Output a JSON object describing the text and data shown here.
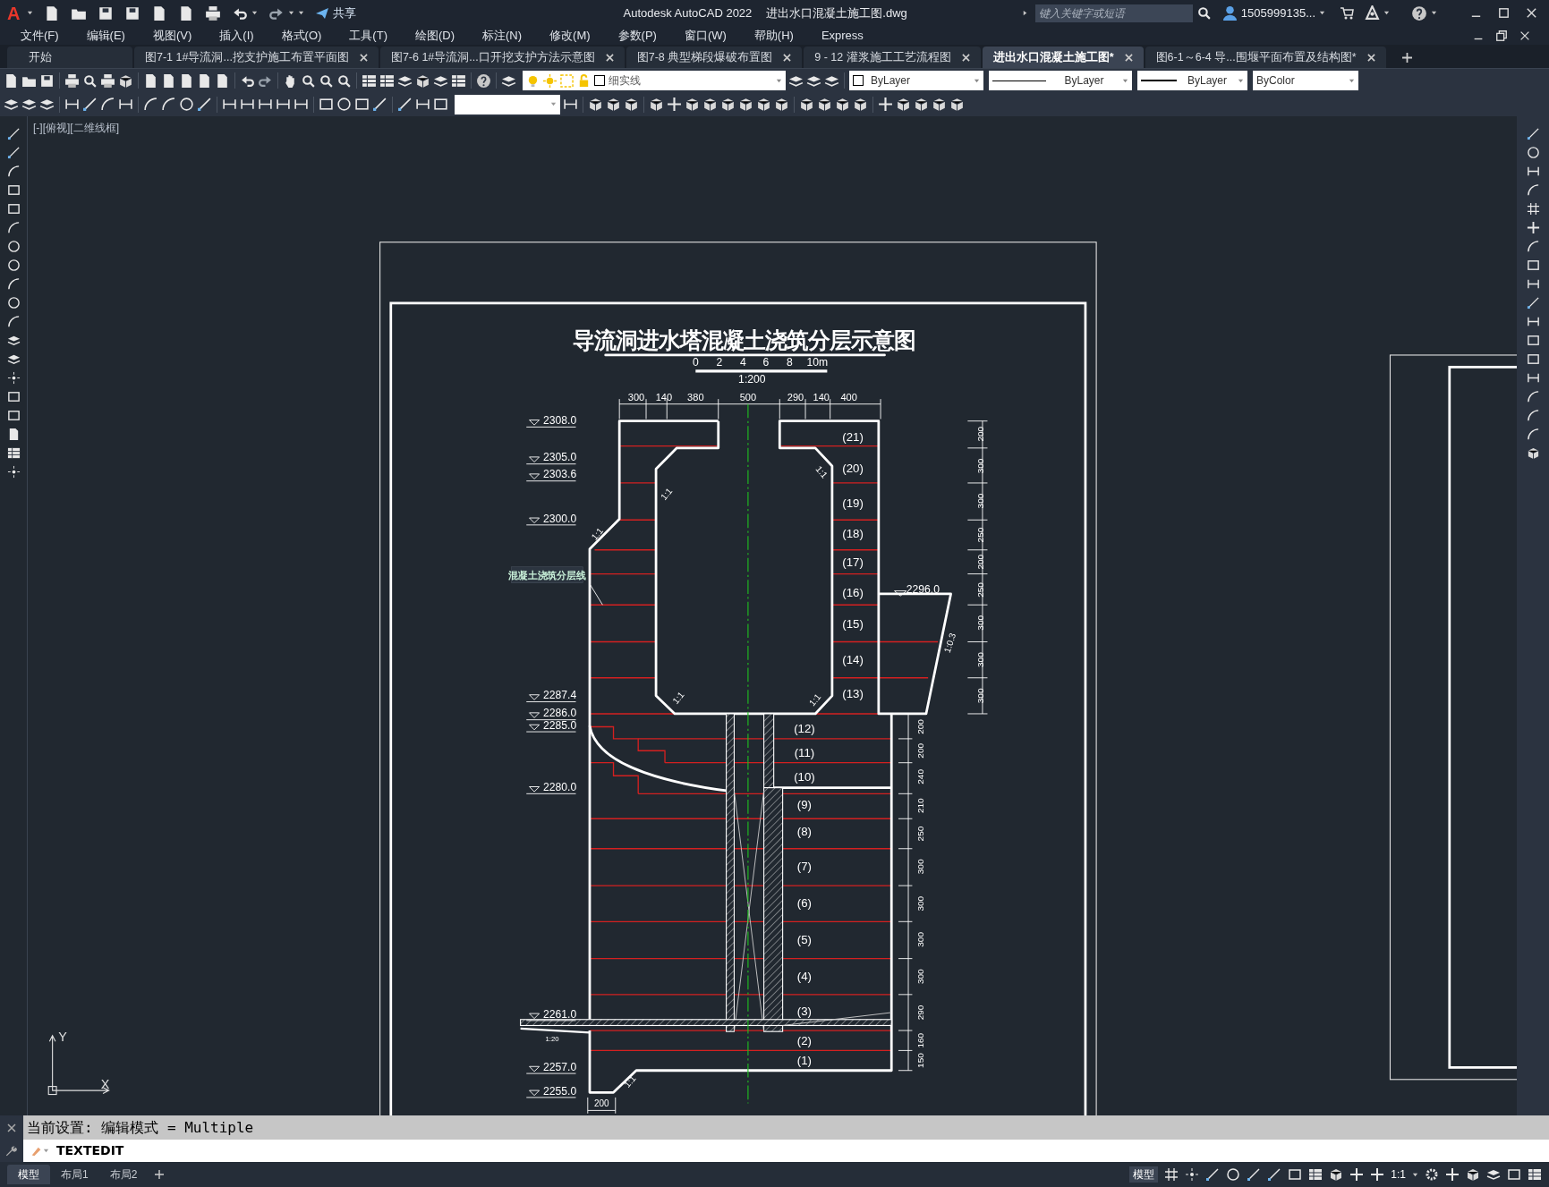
{
  "logo": "A",
  "quick_access": {
    "share": "共享"
  },
  "window": {
    "title": "Autodesk AutoCAD 2022",
    "file": "进出水口混凝土施工图.dwg"
  },
  "search": {
    "placeholder": "键入关键字或短语"
  },
  "user": {
    "name": "1505999135..."
  },
  "menu": [
    "文件(F)",
    "编辑(E)",
    "视图(V)",
    "插入(I)",
    "格式(O)",
    "工具(T)",
    "绘图(D)",
    "标注(N)",
    "修改(M)",
    "参数(P)",
    "窗口(W)",
    "帮助(H)",
    "Express"
  ],
  "tabs": [
    {
      "label": "开始",
      "selected": false,
      "closable": false
    },
    {
      "label": "图7-1 1#导流洞...挖支护施工布置平面图",
      "selected": false,
      "closable": true
    },
    {
      "label": "图7-6 1#导流洞...口开挖支护方法示意图",
      "selected": false,
      "closable": true
    },
    {
      "label": "图7-8 典型梯段爆破布置图",
      "selected": false,
      "closable": true
    },
    {
      "label": "9 - 12 灌浆施工工艺流程图",
      "selected": false,
      "closable": true
    },
    {
      "label": "进出水口混凝土施工图*",
      "selected": true,
      "closable": true
    },
    {
      "label": "图6-1～6-4 导...围堰平面布置及结构图*",
      "selected": false,
      "closable": true
    }
  ],
  "properties": {
    "layer": "细实线",
    "color_setting": "ByLayer",
    "linetype": "ByLayer",
    "lineweight": "ByLayer",
    "plot_style": "ByColor"
  },
  "viewport_label": "[-][俯视][二维线框]",
  "drawing": {
    "title": "导流洞进水塔混凝土浇筑分层示意图",
    "scale_ticks": [
      "0",
      "2",
      "4",
      "6",
      "8",
      "10m"
    ],
    "scale_ratio": "1:200",
    "top_dims": [
      "300",
      "140",
      "380",
      "500",
      "290",
      "140",
      "400"
    ],
    "elevations": [
      "2308.0",
      "2305.0",
      "2303.6",
      "2300.0",
      "2287.4",
      "2286.0",
      "2285.0",
      "2280.0",
      "2261.0",
      "2257.0",
      "2255.0"
    ],
    "right_elevation": "2296.0",
    "layers": [
      "(21)",
      "(20)",
      "(19)",
      "(18)",
      "(17)",
      "(16)",
      "(15)",
      "(14)",
      "(13)",
      "(12)",
      "(11)",
      "(10)",
      "(9)",
      "(8)",
      "(7)",
      "(6)",
      "(5)",
      "(4)",
      "(3)",
      "(2)",
      "(1)"
    ],
    "upper_dims": [
      "200",
      "300",
      "300",
      "250",
      "200",
      "250",
      "300",
      "300",
      "300"
    ],
    "lower_dims": [
      "200",
      "200",
      "240",
      "210",
      "250",
      "300",
      "300",
      "300",
      "300",
      "290",
      "160",
      "150"
    ],
    "slopes": [
      "1:1",
      "1:1",
      "1:1",
      "1:1",
      "1:1",
      "1:1",
      "1:0.3",
      "1:20"
    ],
    "callout": "混凝土浇筑分层线",
    "bottom_dim": "200",
    "ucs": {
      "y": "Y",
      "x": "X"
    }
  },
  "command": {
    "history": "当前设置: 编辑模式 = Multiple",
    "input": "TEXTEDIT"
  },
  "layout_tabs": [
    {
      "label": "模型",
      "selected": true
    },
    {
      "label": "布局1",
      "selected": false
    },
    {
      "label": "布局2",
      "selected": false
    }
  ],
  "status_bar": {
    "space": "模型",
    "scale": "1:1"
  }
}
